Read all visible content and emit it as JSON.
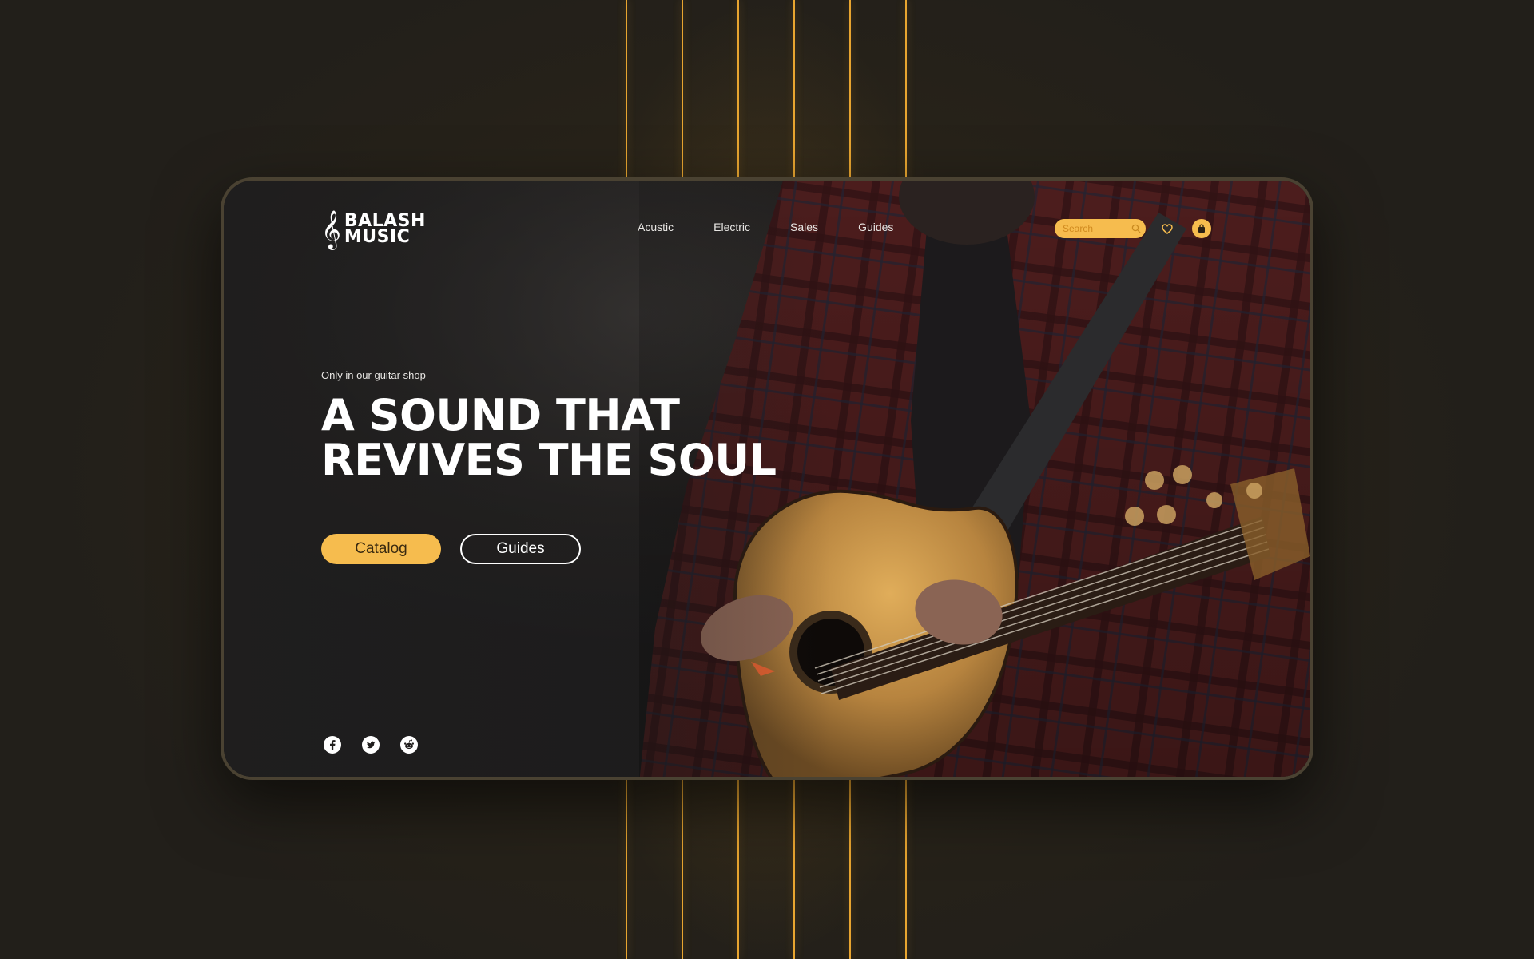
{
  "brand": {
    "name_line1": "BALASH",
    "name_line2": "MUSIC"
  },
  "nav": {
    "items": [
      "Acustic",
      "Electric",
      "Sales",
      "Guides"
    ]
  },
  "search": {
    "placeholder": "Search"
  },
  "hero": {
    "tagline": "Only in our guitar shop",
    "headline_line1": "A SOUND THAT",
    "headline_line2": "REVIVES THE SOUL",
    "primary_button": "Catalog",
    "secondary_button": "Guides"
  },
  "socials": [
    "facebook-icon",
    "twitter-icon",
    "reddit-icon"
  ],
  "icons": {
    "logo": "treble-clef-icon",
    "search": "search-icon",
    "wishlist": "heart-icon",
    "cart": "shopping-bag-icon"
  },
  "colors": {
    "accent": "#f6bc4e",
    "string": "#e8a530",
    "background": "#221f1a",
    "card": "#201e1d",
    "text": "#ffffff"
  }
}
